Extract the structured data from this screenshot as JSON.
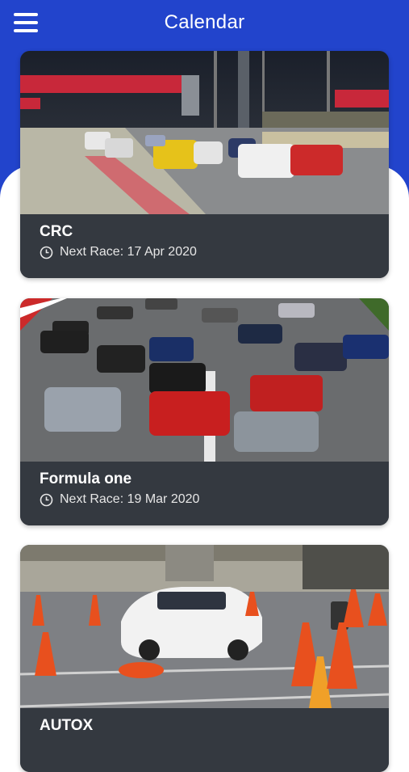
{
  "header": {
    "title": "Calendar",
    "menu_icon": "hamburger-menu-icon"
  },
  "colors": {
    "header_bg": "#2244cc",
    "card_info_bg": "#343940"
  },
  "events": [
    {
      "name": "CRC",
      "next_race": "Next Race: 17 Apr 2020",
      "image": "night racing circuit with cars"
    },
    {
      "name": "Formula one",
      "next_race": "Next Race: 19 Mar 2020",
      "image": "formula one cars racing"
    },
    {
      "name": "AUTOX",
      "next_race": "",
      "image": "white car among traffic cones"
    }
  ]
}
